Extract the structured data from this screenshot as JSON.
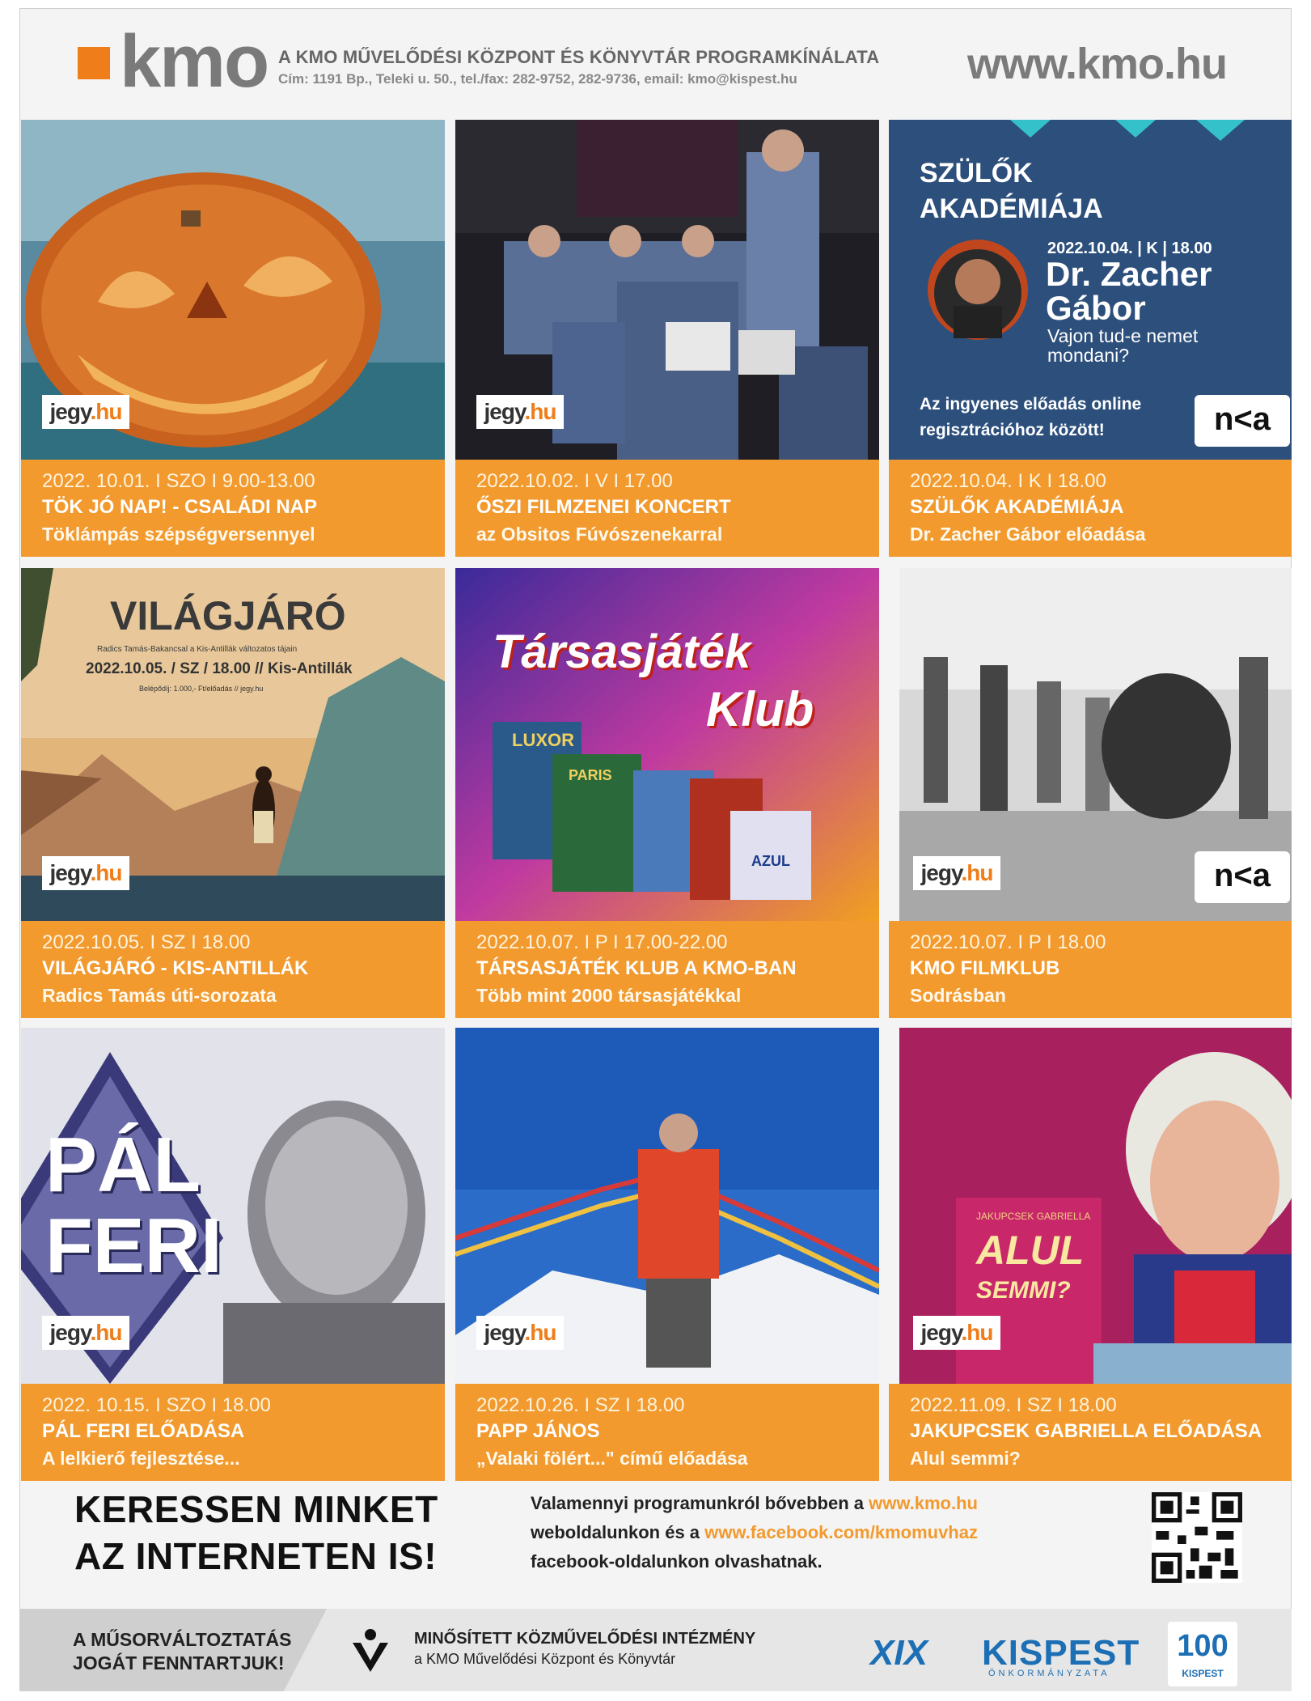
{
  "header": {
    "logo": "kmo",
    "title": "A KMO MŰVELŐDÉSI KÖZPONT ÉS KÖNYVTÁR PROGRAMKÍNÁLATA",
    "address": "Cím: 1191 Bp., Teleki u. 50., tel./fax: 282-9752, 282-9736, email: kmo@kispest.hu",
    "url": "www.kmo.hu"
  },
  "badges": {
    "jegy": "jegy",
    "jegy_hu": ".hu",
    "nka": "n<a"
  },
  "poster3": {
    "heading1": "SZÜLŐK",
    "heading2": "AKADÉMIÁJA",
    "date": "2022.10.04. | K | 18.00",
    "name1": "Dr. Zacher",
    "name2": "Gábor",
    "topic1": "Vajon tud-e nemet",
    "topic2": "mondani?",
    "note1": "Az ingyenes előadás online",
    "note2": "regisztrációhoz között!"
  },
  "poster4": {
    "title": "VILÁGJÁRÓ",
    "line": "Radics Tamás-Bakancsal a Kis-Antillák változatos tájain",
    "date": "2022.10.05. / SZ / 18.00 // Kis-Antillák",
    "price": "Belépődíj: 1.000,- Ft/előadás // jegy.hu"
  },
  "poster5": {
    "line1": "Társasjáték",
    "line2": "Klub",
    "box1": "LUXOR",
    "box2": "PARIS",
    "box3": "AZUL"
  },
  "poster7": {
    "line1": "PÁL",
    "line2": "FERI"
  },
  "poster9": {
    "author": "JAKUPCSEK GABRIELLA",
    "book1": "ALUL",
    "book2": "SEMMI?"
  },
  "events": [
    {
      "date": "2022. 10.01. I SZO I 9.00-13.00",
      "title": "TÖK JÓ NAP! - CSALÁDI NAP",
      "sub": "Töklámpás szépségversennyel"
    },
    {
      "date": "2022.10.02. I V I 17.00",
      "title": "ŐSZI FILMZENEI KONCERT",
      "sub": "az Obsitos Fúvószenekarral"
    },
    {
      "date": "2022.10.04. I K I 18.00",
      "title": "SZÜLŐK AKADÉMIÁJA",
      "sub": "Dr. Zacher Gábor előadása"
    },
    {
      "date": "2022.10.05. I SZ I 18.00",
      "title": "VILÁGJÁRÓ - KIS-ANTILLÁK",
      "sub": "Radics Tamás úti-sorozata"
    },
    {
      "date": "2022.10.07. I P I 17.00-22.00",
      "title": "TÁRSASJÁTÉK KLUB A KMO-BAN",
      "sub": "Több mint 2000 társasjátékkal"
    },
    {
      "date": "2022.10.07. I P I 18.00",
      "title": "KMO FILMKLUB",
      "sub": "Sodrásban"
    },
    {
      "date": "2022. 10.15. I SZO I 18.00",
      "title": "PÁL FERI ELŐADÁSA",
      "sub": "A lelkierő fejlesztése..."
    },
    {
      "date": "2022.10.26. I SZ I 18.00",
      "title": "PAPP JÁNOS",
      "sub": "„Valaki fölért...\" című előadása"
    },
    {
      "date": "2022.11.09. I SZ I 18.00",
      "title": "JAKUPCSEK GABRIELLA ELŐADÁSA",
      "sub": "Alul semmi?"
    }
  ],
  "banner": {
    "line1": "KERESSEN MINKET",
    "line2": "AZ INTERNETEN IS!",
    "t1": "Valamennyi programunkról bővebben a ",
    "link1": "www.kmo.hu",
    "t2": "weboldalunkon és a ",
    "link2": "www.facebook.com/kmomuvhaz",
    "t3": "facebook-oldalunkon olvashatnak."
  },
  "footer": {
    "warn1": "A MŰSORVÁLTOZTATÁS",
    "warn2": "JOGÁT FENNTARTJUK!",
    "qual1": "MINŐSÍTETT KÖZMŰVELŐDÉSI INTÉZMÉNY",
    "qual2": "a KMO Művelődési Központ és Könyvtár",
    "xix": "XIX",
    "kispest": "KISPEST",
    "onkorm": "ÖNKORMÁNYZATA",
    "k100": "KISPEST"
  }
}
